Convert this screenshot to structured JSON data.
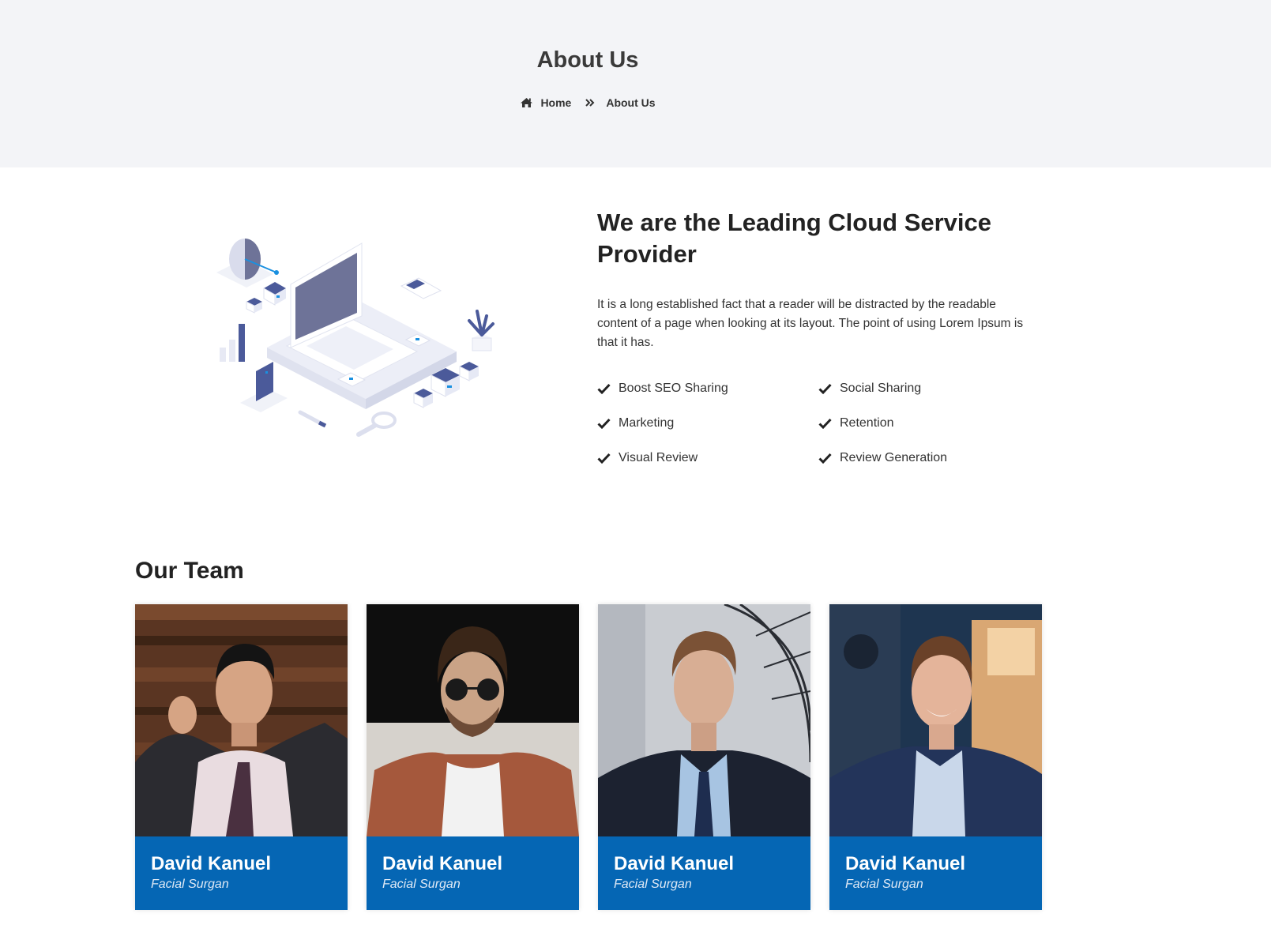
{
  "hero": {
    "title": "About Us",
    "breadcrumb": [
      {
        "label": "Home",
        "icon": "home-icon"
      },
      {
        "label": "About Us",
        "icon": "double-chevron-right-icon"
      }
    ]
  },
  "about": {
    "heading": "We are the Leading Cloud Service Provider",
    "paragraph": "It is a long established fact that a reader will be distracted by the readable content of a page when looking at its layout. The point of using Lorem Ipsum is that it has.",
    "features": [
      "Boost SEO Sharing",
      "Social Sharing",
      "Marketing",
      "Retention",
      "Visual Review",
      "Review Generation"
    ],
    "illustration": "isometric-laptop-illustration"
  },
  "team": {
    "title": "Our Team",
    "members": [
      {
        "name": "David Kanuel",
        "role": "Facial Surgan"
      },
      {
        "name": "David Kanuel",
        "role": "Facial Surgan"
      },
      {
        "name": "David Kanuel",
        "role": "Facial Surgan"
      },
      {
        "name": "David Kanuel",
        "role": "Facial Surgan"
      }
    ]
  },
  "colors": {
    "hero_bg": "#f3f4f7",
    "accent": "#0566b4",
    "text": "#222222"
  }
}
